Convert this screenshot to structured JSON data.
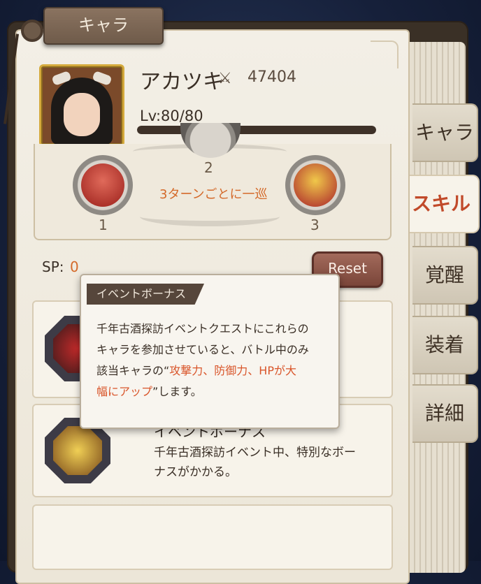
{
  "window_tag": "キャラ",
  "character": {
    "name": "アカツキ",
    "power": "47404",
    "level": "Lv:80/80",
    "xp_progress": 1.0
  },
  "tabs": [
    {
      "label": "キャラ",
      "active": false
    },
    {
      "label": "スキル",
      "active": true
    },
    {
      "label": "覚醒",
      "active": false
    },
    {
      "label": "装着",
      "active": false
    },
    {
      "label": "詳細",
      "active": false
    }
  ],
  "rotation": {
    "cycle_text": "3ターンごとに一巡",
    "order": [
      "1",
      "2",
      "3"
    ]
  },
  "sp": {
    "label": "SP:",
    "value": "0",
    "reset_label": "Reset"
  },
  "cards": [
    {
      "title": "イベントボーナス",
      "desc": "千年古酒探訪イベント中、特別なボーナスがかかる。"
    }
  ],
  "tooltip": {
    "tag": "イベントボーナス",
    "line1": "千年古酒探訪イベントクエストにこれらの",
    "line2": "キャラを参加させていると、バトル中のみ",
    "line3_prefix": "該当キャラの“",
    "line3_highlight": "攻撃力、防御力、HPが大",
    "line4_highlight": "幅にアップ",
    "line4_suffix": "”します。"
  }
}
